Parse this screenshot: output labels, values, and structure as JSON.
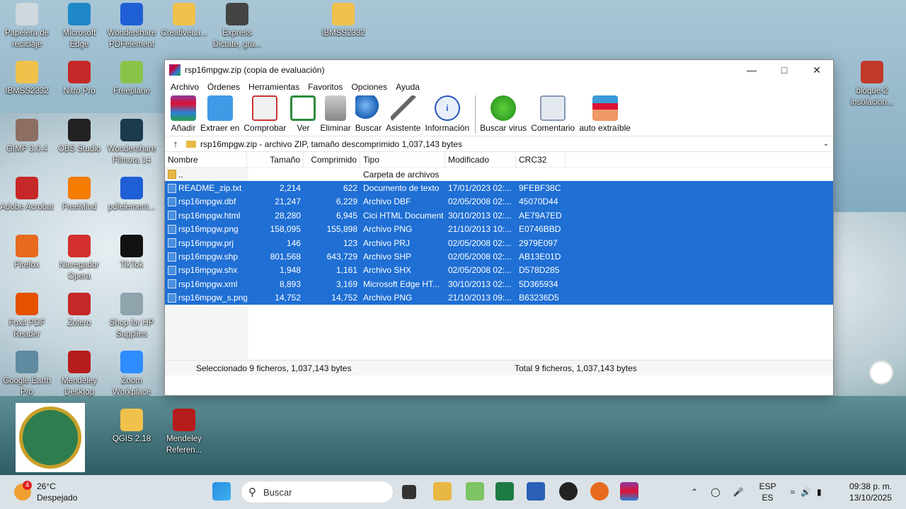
{
  "desktop": {
    "icons": [
      {
        "label": "Papelera de reciclaje",
        "icon": "recycle-bin-icon"
      },
      {
        "label": "Microsoft Edge",
        "icon": "edge-icon"
      },
      {
        "label": "Wondershare PDFelement",
        "icon": "pdfelement-icon"
      },
      {
        "label": "CreativeLa...",
        "icon": "folder-icon"
      },
      {
        "label": "Express Dictate, gra...",
        "icon": "dictate-icon"
      },
      {
        "label": "IBMSS2332",
        "icon": "folder-icon"
      },
      {
        "label": "IBMSS2332",
        "icon": "folder-icon"
      },
      {
        "label": "Nitro Pro",
        "icon": "nitro-icon"
      },
      {
        "label": "Freeplane",
        "icon": "freeplane-icon"
      },
      {
        "label": "bloque-2 insolacion...",
        "icon": "pptx-icon"
      },
      {
        "label": "GIMP 3.0.4",
        "icon": "gimp-icon"
      },
      {
        "label": "OBS Studio",
        "icon": "obs-icon"
      },
      {
        "label": "Wondershare Filmora 14",
        "icon": "filmora-icon"
      },
      {
        "label": "Adobe Acrobat",
        "icon": "acrobat-icon"
      },
      {
        "label": "FreeMind",
        "icon": "freemind-icon"
      },
      {
        "label": "pdfelement...",
        "icon": "pdfelement-icon"
      },
      {
        "label": "Firefox",
        "icon": "firefox-icon"
      },
      {
        "label": "Navegador Opera",
        "icon": "opera-icon"
      },
      {
        "label": "TikTok",
        "icon": "tiktok-icon"
      },
      {
        "label": "Foxit PDF Reader",
        "icon": "foxit-icon"
      },
      {
        "label": "Zotero",
        "icon": "zotero-icon"
      },
      {
        "label": "Shop for HP Supplies",
        "icon": "hp-icon"
      },
      {
        "label": "Google Earth Pro",
        "icon": "earth-icon"
      },
      {
        "label": "Mendeley Desktop",
        "icon": "mendeley-icon"
      },
      {
        "label": "Zoom Workplace",
        "icon": "zoom-icon"
      },
      {
        "label": "QGIS 2.18",
        "icon": "folder-icon"
      },
      {
        "label": "Mendeley Referen...",
        "icon": "mendeley-icon"
      }
    ]
  },
  "window": {
    "title": "rsp16mpgw.zip (copia de evaluación)",
    "menu": [
      "Archivo",
      "Órdenes",
      "Herramientas",
      "Favoritos",
      "Opciones",
      "Ayuda"
    ],
    "toolbar": [
      "Añadir",
      "Extraer en",
      "Comprobar",
      "Ver",
      "Eliminar",
      "Buscar",
      "Asistente",
      "Información",
      "Buscar virus",
      "Comentario",
      "auto extraíble"
    ],
    "address": "rsp16mpgw.zip - archivo ZIP, tamaño descomprimido 1,037,143 bytes",
    "columns": [
      "Nombre",
      "Tamaño",
      "Comprimido",
      "Tipo",
      "Modificado",
      "CRC32"
    ],
    "parent_row": {
      "name": "..",
      "type": "Carpeta de archivos"
    },
    "files": [
      {
        "name": "README_zip.txt",
        "size": "2,214",
        "comp": "622",
        "type": "Documento de texto",
        "mod": "17/01/2023 02:...",
        "crc": "9FEBF38C"
      },
      {
        "name": "rsp16mpgw.dbf",
        "size": "21,247",
        "comp": "6,229",
        "type": "Archivo DBF",
        "mod": "02/05/2008 02:...",
        "crc": "45070D44"
      },
      {
        "name": "rsp16mpgw.html",
        "size": "28,280",
        "comp": "6,945",
        "type": "Cici HTML Document",
        "mod": "30/10/2013 02:...",
        "crc": "AE79A7ED"
      },
      {
        "name": "rsp16mpgw.png",
        "size": "158,095",
        "comp": "155,898",
        "type": "Archivo PNG",
        "mod": "21/10/2013 10:...",
        "crc": "E0746BBD"
      },
      {
        "name": "rsp16mpgw.prj",
        "size": "146",
        "comp": "123",
        "type": "Archivo PRJ",
        "mod": "02/05/2008 02:...",
        "crc": "2979E097"
      },
      {
        "name": "rsp16mpgw.shp",
        "size": "801,568",
        "comp": "643,729",
        "type": "Archivo SHP",
        "mod": "02/05/2008 02:...",
        "crc": "AB13E01D"
      },
      {
        "name": "rsp16mpgw.shx",
        "size": "1,948",
        "comp": "1,161",
        "type": "Archivo SHX",
        "mod": "02/05/2008 02:...",
        "crc": "D578D285"
      },
      {
        "name": "rsp16mpgw.xml",
        "size": "8,893",
        "comp": "3,169",
        "type": "Microsoft Edge HT...",
        "mod": "30/10/2013 02:...",
        "crc": "5D365934"
      },
      {
        "name": "rsp16mpgw_s.png",
        "size": "14,752",
        "comp": "14,752",
        "type": "Archivo PNG",
        "mod": "21/10/2013 09:...",
        "crc": "B63236D5"
      }
    ],
    "status_left": "Seleccionado 9 ficheros, 1,037,143 bytes",
    "status_right": "Total 9 ficheros, 1,037,143 bytes"
  },
  "taskbar": {
    "temp": "26°C",
    "weather": "Despejado",
    "weather_badge": "4",
    "search_placeholder": "Buscar",
    "lang1": "ESP",
    "lang2": "ES",
    "time": "09:38 p. m.",
    "date": "13/10/2025"
  },
  "colors": {
    "selection": "#1f6fd4",
    "accent": "#0067c0"
  }
}
